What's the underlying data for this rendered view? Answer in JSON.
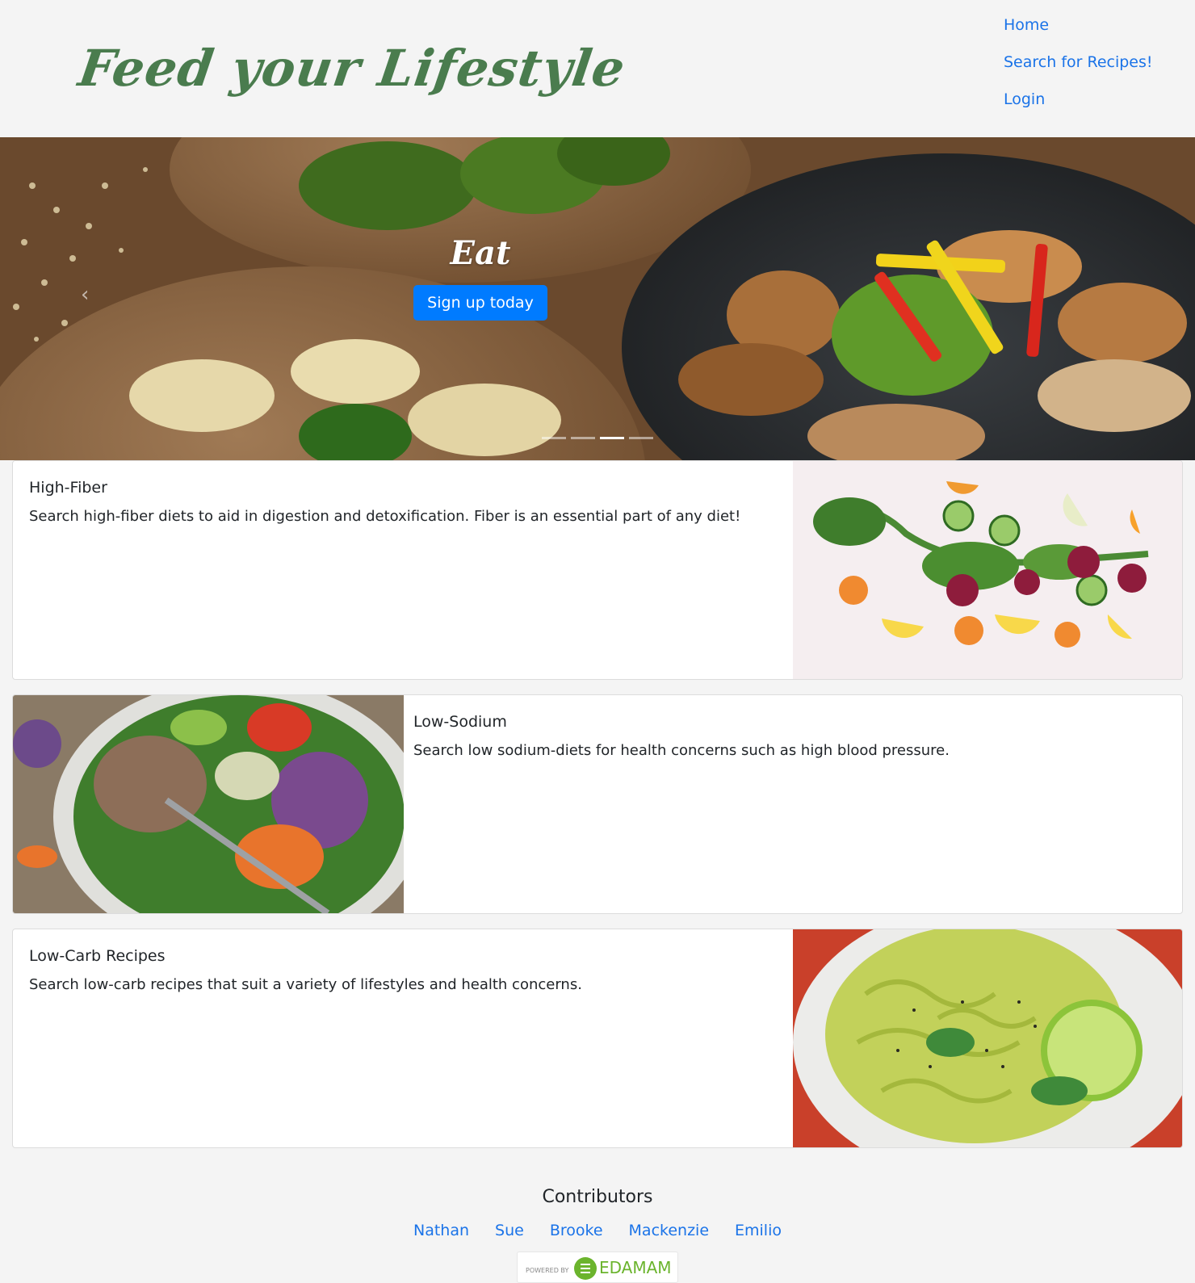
{
  "header": {
    "logo": "Feed your Lifestyle",
    "nav": [
      "Home",
      "Search for Recipes!",
      "Login"
    ]
  },
  "carousel": {
    "caption": "Eat",
    "button": "Sign up today",
    "slide_count": 4,
    "active_slide": 3
  },
  "cards": [
    {
      "title": "High-Fiber",
      "text": "Search high-fiber diets to aid in digestion and detoxification. Fiber is an essential part of any diet!",
      "image": "vegetable-slices-photo"
    },
    {
      "title": "Low-Sodium",
      "text": "Search low sodium-diets for health concerns such as high blood pressure.",
      "image": "salad-bowl-photo"
    },
    {
      "title": "Low-Carb Recipes",
      "text": "Search low-carb recipes that suit a variety of lifestyles and health concerns.",
      "image": "zucchini-noodles-photo"
    }
  ],
  "footer": {
    "heading": "Contributors",
    "contributors": [
      "Nathan",
      "Sue",
      "Brooke",
      "Mackenzie",
      "Emilio"
    ],
    "badge": {
      "powered_by": "POWERED BY",
      "brand": "EDAMAM"
    }
  },
  "colors": {
    "logo": "#4a7c4e",
    "link": "#1a73e8",
    "button": "#007bff",
    "edamam": "#6bb42d"
  }
}
